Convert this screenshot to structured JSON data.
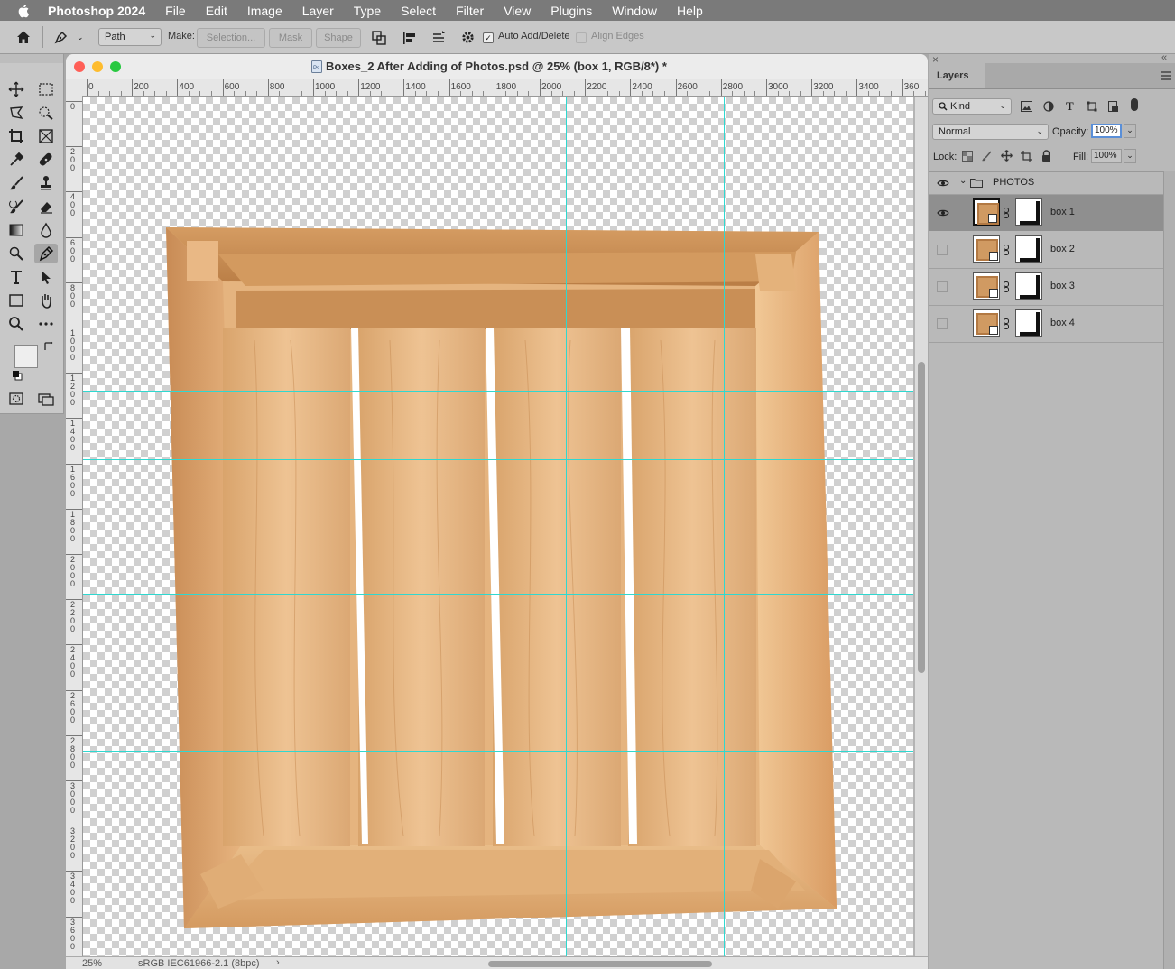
{
  "menubar": {
    "app_name": "Photoshop 2024",
    "items": [
      "File",
      "Edit",
      "Image",
      "Layer",
      "Type",
      "Select",
      "Filter",
      "View",
      "Plugins",
      "Window",
      "Help"
    ]
  },
  "options": {
    "mode_value": "Path",
    "make_label": "Make:",
    "selection_label": "Selection...",
    "mask_label": "Mask",
    "shape_label": "Shape",
    "auto_add_delete_label": "Auto Add/Delete",
    "auto_add_delete_checked": true,
    "align_edges_label": "Align Edges"
  },
  "document": {
    "title": "Boxes_2 After Adding of Photos.psd @ 25% (box 1, RGB/8*) *",
    "zoom": "25%",
    "color_profile": "sRGB IEC61966-2.1 (8bpc)",
    "ruler_top_labels": [
      "0",
      "200",
      "400",
      "600",
      "800",
      "1000",
      "1200",
      "1400",
      "1600",
      "1800",
      "2000",
      "2200",
      "2400",
      "2600",
      "2800",
      "3000",
      "3200",
      "3400",
      "360"
    ],
    "ruler_left_labels": [
      "0",
      "200",
      "400",
      "600",
      "800",
      "1000",
      "1200",
      "1400",
      "1600",
      "1800",
      "2000",
      "2200",
      "2400",
      "2600",
      "2800",
      "3000",
      "3200",
      "3400",
      "3600"
    ]
  },
  "layers_panel": {
    "tab_label": "Layers",
    "filter_kind": "Kind",
    "blend_mode": "Normal",
    "opacity_label": "Opacity:",
    "opacity_value": "100%",
    "lock_label": "Lock:",
    "fill_label": "Fill:",
    "fill_value": "100%",
    "group_name": "PHOTOS",
    "layers": [
      {
        "name": "box 1",
        "visible": true,
        "selected": true
      },
      {
        "name": "box 2",
        "visible": false,
        "selected": false
      },
      {
        "name": "box 3",
        "visible": false,
        "selected": false
      },
      {
        "name": "box 4",
        "visible": false,
        "selected": false
      }
    ]
  },
  "colors": {
    "guide": "#2fd8d0",
    "menubar": "#7a7a7a",
    "selected_layer": "#8f8f8f",
    "wood_light": "#e8b884",
    "wood_dark": "#c98d57"
  }
}
